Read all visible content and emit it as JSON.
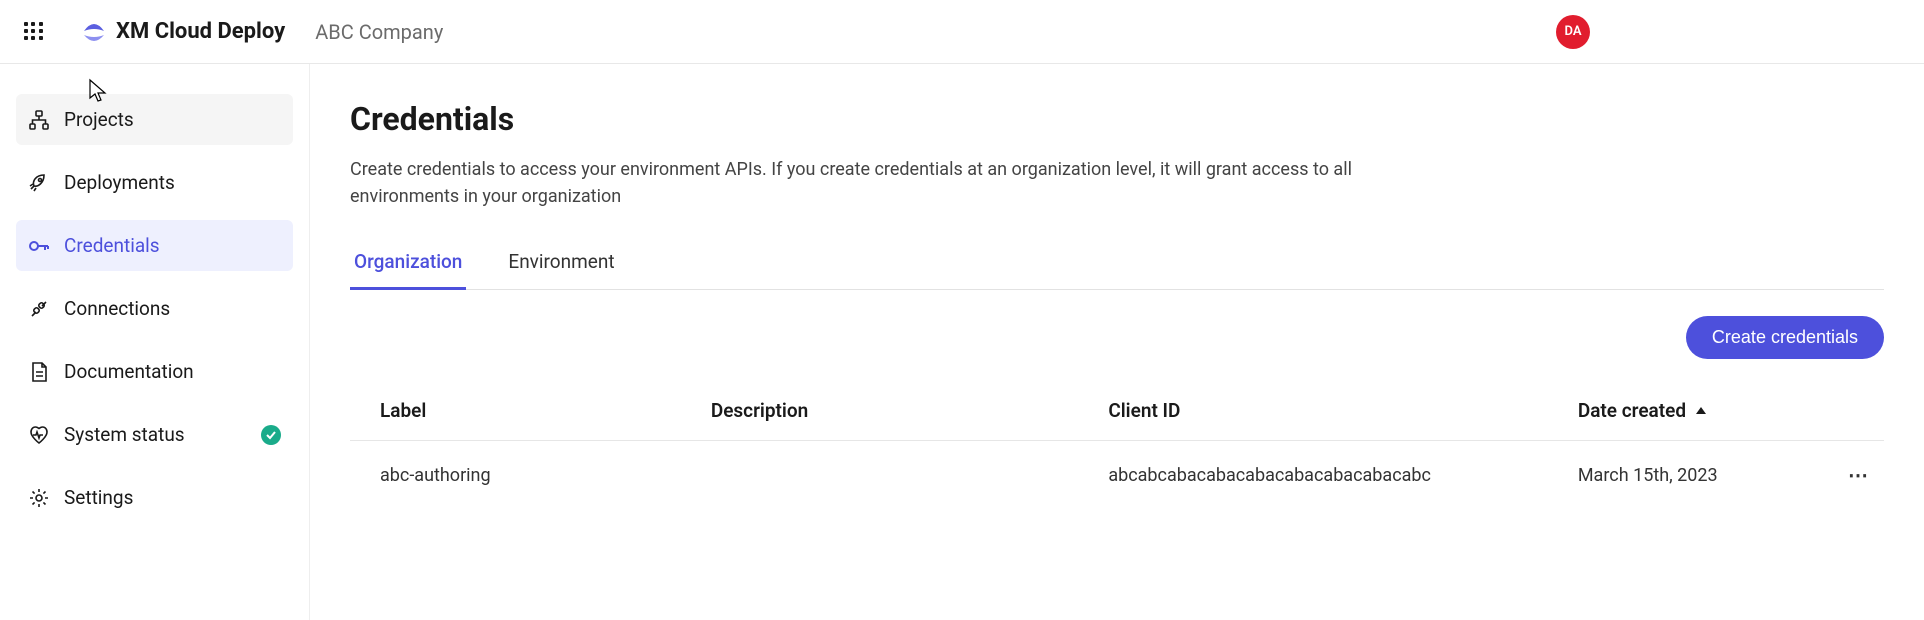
{
  "header": {
    "app_title": "XM Cloud Deploy",
    "org_name": "ABC Company",
    "avatar_initials": "DA"
  },
  "sidebar": {
    "items": [
      {
        "label": "Projects",
        "icon": "sitemap-icon",
        "active": false
      },
      {
        "label": "Deployments",
        "icon": "rocket-icon",
        "active": false
      },
      {
        "label": "Credentials",
        "icon": "key-icon",
        "active": true
      },
      {
        "label": "Connections",
        "icon": "plug-icon",
        "active": false
      },
      {
        "label": "Documentation",
        "icon": "document-icon",
        "active": false
      },
      {
        "label": "System status",
        "icon": "heartbeat-icon",
        "active": false,
        "status_ok": true
      },
      {
        "label": "Settings",
        "icon": "gear-icon",
        "active": false
      }
    ]
  },
  "main": {
    "page_title": "Credentials",
    "page_description": "Create credentials to access your environment APIs. If you create credentials at an organization level, it will grant access to all environments in your organization",
    "tabs": [
      {
        "label": "Organization",
        "active": true
      },
      {
        "label": "Environment",
        "active": false
      }
    ],
    "create_button_label": "Create credentials",
    "table": {
      "columns": {
        "label": "Label",
        "description": "Description",
        "client_id": "Client ID",
        "date_created": "Date created"
      },
      "sort": {
        "column": "date_created",
        "direction": "asc"
      },
      "rows": [
        {
          "label": "abc-authoring",
          "description": "",
          "client_id": "abcabcabacabacabacabacabacabacabc",
          "date_created": "March 15th, 2023"
        }
      ]
    }
  }
}
